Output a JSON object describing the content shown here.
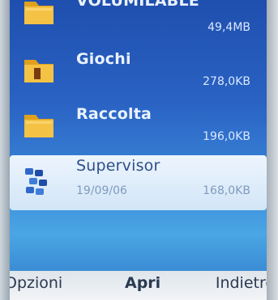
{
  "list": {
    "items": [
      {
        "name": "VOLUMILABLE",
        "size": "49,4MB",
        "icon": "folder-icon"
      },
      {
        "name": "Giochi",
        "size": "278,0KB",
        "icon": "folder-icon"
      },
      {
        "name": "Raccolta",
        "size": "196,0KB",
        "icon": "folder-icon"
      },
      {
        "name": "Supervisor",
        "date": "19/09/06",
        "size": "168,0KB",
        "icon": "app-blocks-icon",
        "selected": true
      }
    ]
  },
  "softkeys": {
    "left": "Opzioni",
    "middle": "Apri",
    "right": "Indietro"
  },
  "colors": {
    "background_top": "#1f4fae",
    "background_mid": "#3a86d8",
    "selection": "#eaf4ff",
    "text": "#eaf2ff"
  }
}
